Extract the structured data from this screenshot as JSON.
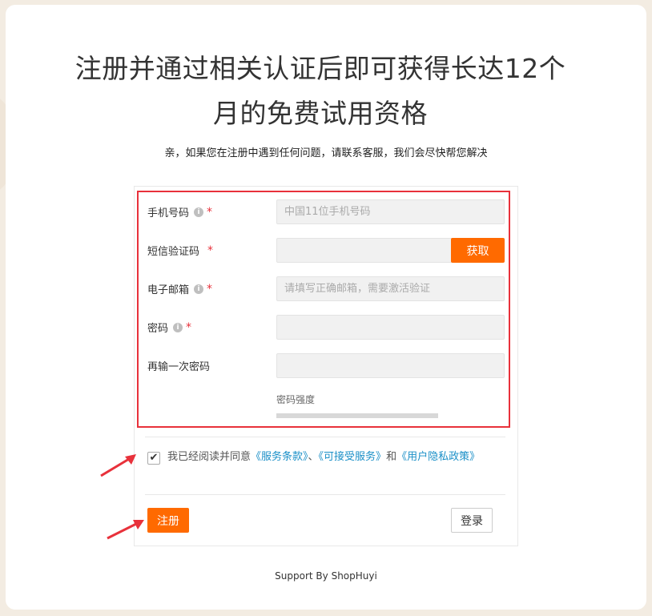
{
  "headline_line1": "注册并通过相关认证后即可获得长达12个",
  "headline_line2": "月的免费试用资格",
  "subtitle": "亲，如果您在注册中遇到任何问题，请联系客服，我们会尽快帮您解决",
  "form": {
    "phone": {
      "label": "手机号码",
      "placeholder": "中国11位手机号码",
      "required": "*"
    },
    "sms": {
      "label": "短信验证码",
      "required": "*",
      "button": "获取"
    },
    "email": {
      "label": "电子邮箱",
      "placeholder": "请填写正确邮箱，需要激活验证",
      "required": "*"
    },
    "password": {
      "label": "密码",
      "required": "*"
    },
    "confirm": {
      "label": "再输一次密码"
    },
    "strength_label": "密码强度"
  },
  "agreement": {
    "checked": "✔",
    "prefix": "我已经阅读并同意",
    "link1": "《服务条款》",
    "sep1": "、",
    "link2": "《可接受服务》",
    "sep2": "和",
    "link3": "《用户隐私政策》"
  },
  "buttons": {
    "register": "注册",
    "login": "登录"
  },
  "footer": "Support By ShopHuyi",
  "info_icon": "i",
  "colors": {
    "accent": "#ff6a00",
    "highlight": "#e8313b",
    "link": "#1a8fc7"
  }
}
